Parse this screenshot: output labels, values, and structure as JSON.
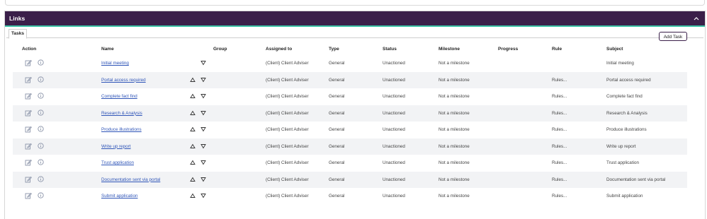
{
  "panel": {
    "title": "Links"
  },
  "tabs": [
    {
      "label": "Tasks"
    }
  ],
  "add_task_label": "Add Task",
  "columns": {
    "action": "Action",
    "name": "Name",
    "group": "Group",
    "assigned_to": "Assigned to",
    "type": "Type",
    "status": "Status",
    "milestone": "Milestone",
    "progress": "Progress",
    "rule": "Rule",
    "subject": "Subject"
  },
  "rows": [
    {
      "name": "Initial meeting",
      "assigned_to": "(Client) Client Adviser",
      "type": "General",
      "status": "Unactioned",
      "milestone": "Not a milestone",
      "progress": "",
      "rule": "",
      "subject": "Initial meeting",
      "up": false,
      "down": true
    },
    {
      "name": "Portal access required",
      "assigned_to": "(Client) Client Adviser",
      "type": "General",
      "status": "Unactioned",
      "milestone": "Not a milestone",
      "progress": "",
      "rule": "Rules...",
      "subject": "Portal access required",
      "up": true,
      "down": true
    },
    {
      "name": "Complete fact find",
      "assigned_to": "(Client) Client Adviser",
      "type": "General",
      "status": "Unactioned",
      "milestone": "Not a milestone",
      "progress": "",
      "rule": "Rules...",
      "subject": "Complete fact find",
      "up": true,
      "down": true
    },
    {
      "name": "Research & Analysis",
      "assigned_to": "(Client) Client Adviser",
      "type": "General",
      "status": "Unactioned",
      "milestone": "Not a milestone",
      "progress": "",
      "rule": "Rules...",
      "subject": "Research & Analysis",
      "up": true,
      "down": true
    },
    {
      "name": "Produce illustrations",
      "assigned_to": "(Client) Client Adviser",
      "type": "General",
      "status": "Unactioned",
      "milestone": "Not a milestone",
      "progress": "",
      "rule": "Rules...",
      "subject": "Produce illustrations",
      "up": true,
      "down": true
    },
    {
      "name": "Write up report",
      "assigned_to": "(Client) Client Adviser",
      "type": "General",
      "status": "Unactioned",
      "milestone": "Not a milestone",
      "progress": "",
      "rule": "Rules...",
      "subject": "Write up report",
      "up": true,
      "down": true
    },
    {
      "name": "Trust application",
      "assigned_to": "(Client) Client Adviser",
      "type": "General",
      "status": "Unactioned",
      "milestone": "Not a milestone",
      "progress": "",
      "rule": "Rules...",
      "subject": "Trust application",
      "up": true,
      "down": true
    },
    {
      "name": "Documentation sent via portal",
      "assigned_to": "(Client) Client Adviser",
      "type": "General",
      "status": "Unactioned",
      "milestone": "Not a milestone",
      "progress": "",
      "rule": "Rules...",
      "subject": "Documentation sent via portal",
      "up": true,
      "down": true
    },
    {
      "name": "Submit application",
      "assigned_to": "(Client) Client Adviser",
      "type": "General",
      "status": "Unactioned",
      "milestone": "Not a milestone",
      "progress": "",
      "rule": "Rules...",
      "subject": "Submit application",
      "up": true,
      "down": true
    }
  ],
  "icons": {
    "edit": "edit-icon",
    "info": "info-icon",
    "up": "triangle-up-icon",
    "down": "triangle-down-icon",
    "collapse": "chevron-up-icon"
  },
  "colors": {
    "header_bg": "#3a1f49",
    "header_accent": "#3cc2a6",
    "link": "#2f55b8",
    "row_alt": "#f2f3f5"
  }
}
